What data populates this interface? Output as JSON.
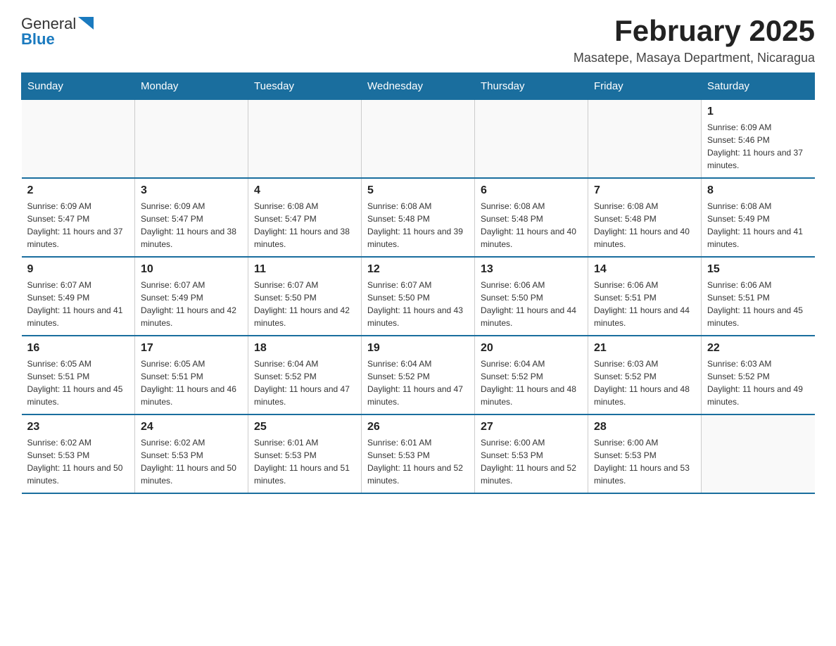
{
  "header": {
    "logo_general": "General",
    "logo_blue": "Blue",
    "title": "February 2025",
    "location": "Masatepe, Masaya Department, Nicaragua"
  },
  "weekdays": [
    "Sunday",
    "Monday",
    "Tuesday",
    "Wednesday",
    "Thursday",
    "Friday",
    "Saturday"
  ],
  "weeks": [
    [
      {
        "day": "",
        "info": ""
      },
      {
        "day": "",
        "info": ""
      },
      {
        "day": "",
        "info": ""
      },
      {
        "day": "",
        "info": ""
      },
      {
        "day": "",
        "info": ""
      },
      {
        "day": "",
        "info": ""
      },
      {
        "day": "1",
        "info": "Sunrise: 6:09 AM\nSunset: 5:46 PM\nDaylight: 11 hours and 37 minutes."
      }
    ],
    [
      {
        "day": "2",
        "info": "Sunrise: 6:09 AM\nSunset: 5:47 PM\nDaylight: 11 hours and 37 minutes."
      },
      {
        "day": "3",
        "info": "Sunrise: 6:09 AM\nSunset: 5:47 PM\nDaylight: 11 hours and 38 minutes."
      },
      {
        "day": "4",
        "info": "Sunrise: 6:08 AM\nSunset: 5:47 PM\nDaylight: 11 hours and 38 minutes."
      },
      {
        "day": "5",
        "info": "Sunrise: 6:08 AM\nSunset: 5:48 PM\nDaylight: 11 hours and 39 minutes."
      },
      {
        "day": "6",
        "info": "Sunrise: 6:08 AM\nSunset: 5:48 PM\nDaylight: 11 hours and 40 minutes."
      },
      {
        "day": "7",
        "info": "Sunrise: 6:08 AM\nSunset: 5:48 PM\nDaylight: 11 hours and 40 minutes."
      },
      {
        "day": "8",
        "info": "Sunrise: 6:08 AM\nSunset: 5:49 PM\nDaylight: 11 hours and 41 minutes."
      }
    ],
    [
      {
        "day": "9",
        "info": "Sunrise: 6:07 AM\nSunset: 5:49 PM\nDaylight: 11 hours and 41 minutes."
      },
      {
        "day": "10",
        "info": "Sunrise: 6:07 AM\nSunset: 5:49 PM\nDaylight: 11 hours and 42 minutes."
      },
      {
        "day": "11",
        "info": "Sunrise: 6:07 AM\nSunset: 5:50 PM\nDaylight: 11 hours and 42 minutes."
      },
      {
        "day": "12",
        "info": "Sunrise: 6:07 AM\nSunset: 5:50 PM\nDaylight: 11 hours and 43 minutes."
      },
      {
        "day": "13",
        "info": "Sunrise: 6:06 AM\nSunset: 5:50 PM\nDaylight: 11 hours and 44 minutes."
      },
      {
        "day": "14",
        "info": "Sunrise: 6:06 AM\nSunset: 5:51 PM\nDaylight: 11 hours and 44 minutes."
      },
      {
        "day": "15",
        "info": "Sunrise: 6:06 AM\nSunset: 5:51 PM\nDaylight: 11 hours and 45 minutes."
      }
    ],
    [
      {
        "day": "16",
        "info": "Sunrise: 6:05 AM\nSunset: 5:51 PM\nDaylight: 11 hours and 45 minutes."
      },
      {
        "day": "17",
        "info": "Sunrise: 6:05 AM\nSunset: 5:51 PM\nDaylight: 11 hours and 46 minutes."
      },
      {
        "day": "18",
        "info": "Sunrise: 6:04 AM\nSunset: 5:52 PM\nDaylight: 11 hours and 47 minutes."
      },
      {
        "day": "19",
        "info": "Sunrise: 6:04 AM\nSunset: 5:52 PM\nDaylight: 11 hours and 47 minutes."
      },
      {
        "day": "20",
        "info": "Sunrise: 6:04 AM\nSunset: 5:52 PM\nDaylight: 11 hours and 48 minutes."
      },
      {
        "day": "21",
        "info": "Sunrise: 6:03 AM\nSunset: 5:52 PM\nDaylight: 11 hours and 48 minutes."
      },
      {
        "day": "22",
        "info": "Sunrise: 6:03 AM\nSunset: 5:52 PM\nDaylight: 11 hours and 49 minutes."
      }
    ],
    [
      {
        "day": "23",
        "info": "Sunrise: 6:02 AM\nSunset: 5:53 PM\nDaylight: 11 hours and 50 minutes."
      },
      {
        "day": "24",
        "info": "Sunrise: 6:02 AM\nSunset: 5:53 PM\nDaylight: 11 hours and 50 minutes."
      },
      {
        "day": "25",
        "info": "Sunrise: 6:01 AM\nSunset: 5:53 PM\nDaylight: 11 hours and 51 minutes."
      },
      {
        "day": "26",
        "info": "Sunrise: 6:01 AM\nSunset: 5:53 PM\nDaylight: 11 hours and 52 minutes."
      },
      {
        "day": "27",
        "info": "Sunrise: 6:00 AM\nSunset: 5:53 PM\nDaylight: 11 hours and 52 minutes."
      },
      {
        "day": "28",
        "info": "Sunrise: 6:00 AM\nSunset: 5:53 PM\nDaylight: 11 hours and 53 minutes."
      },
      {
        "day": "",
        "info": ""
      }
    ]
  ]
}
